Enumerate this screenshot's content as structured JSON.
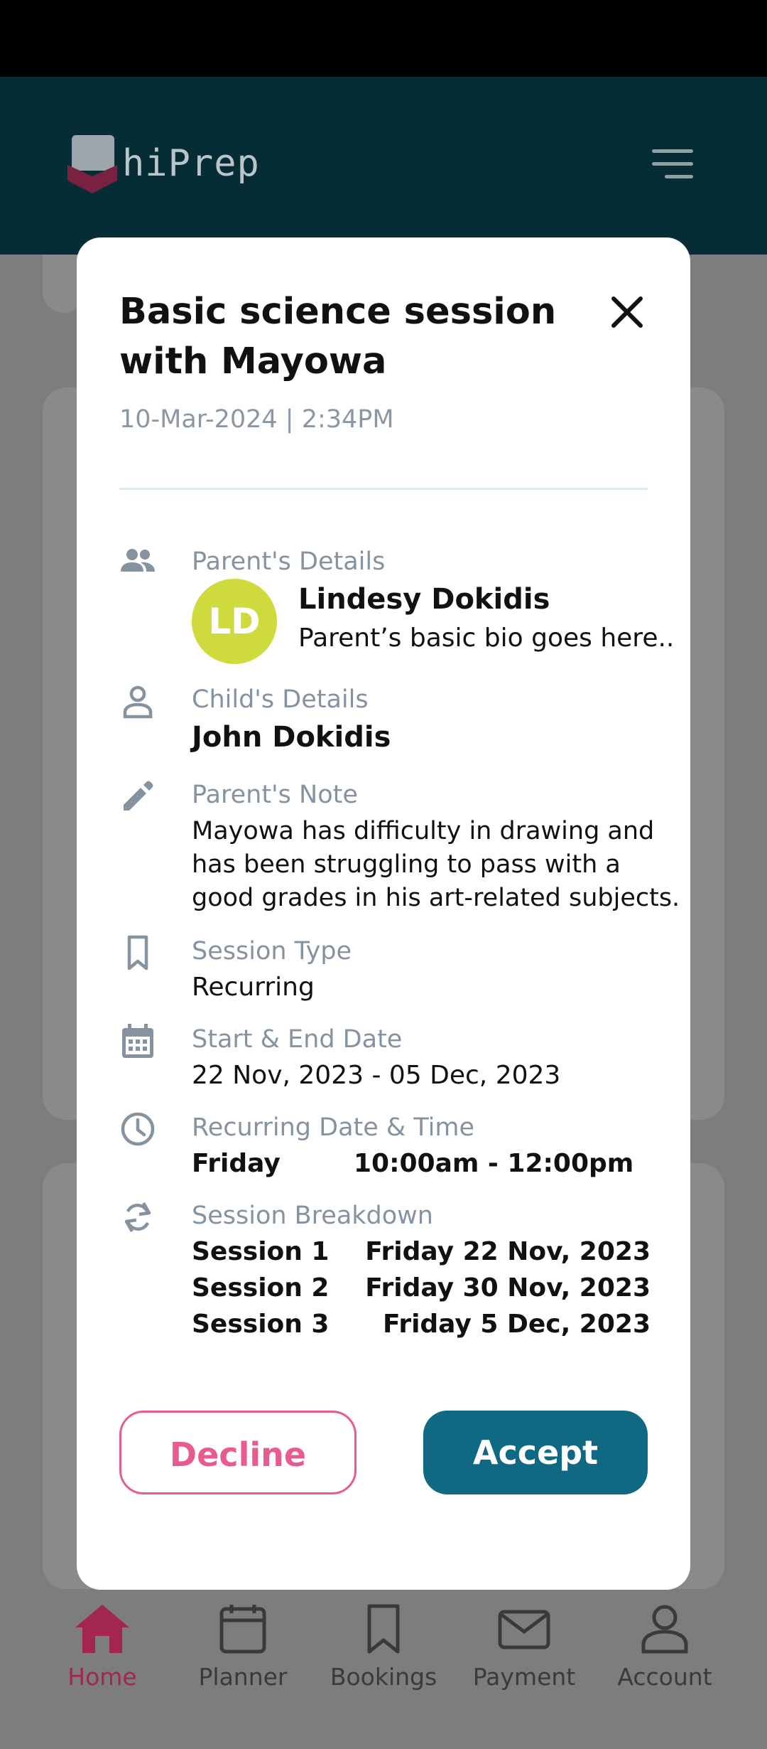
{
  "app": {
    "brand": "hiPrep"
  },
  "modal": {
    "title": "Basic science session with Mayowa",
    "datetime": "10-Mar-2024 | 2:34PM",
    "parent": {
      "label": "Parent's Details",
      "initials": "LD",
      "name": "Lindesy Dokidis",
      "bio": "Parent’s basic bio goes here..",
      "avatar_color": "#cfdb3c"
    },
    "child": {
      "label": "Child's Details",
      "name": "John Dokidis"
    },
    "note": {
      "label": "Parent's Note",
      "text": "Mayowa has difficulty in drawing and has been struggling to pass with a good grades in his art-related subjects."
    },
    "session_type": {
      "label": "Session Type",
      "value": "Recurring"
    },
    "dates": {
      "label": "Start & End Date",
      "value": "22 Nov, 2023 - 05 Dec, 2023"
    },
    "recurring": {
      "label": "Recurring Date & Time",
      "day": "Friday",
      "time": "10:00am - 12:00pm"
    },
    "breakdown": {
      "label": "Session Breakdown",
      "sessions": [
        {
          "name": "Session 1",
          "date": "Friday 22 Nov, 2023"
        },
        {
          "name": "Session 2",
          "date": "Friday 30 Nov, 2023"
        },
        {
          "name": "Session 3",
          "date": "Friday 5 Dec, 2023"
        }
      ]
    },
    "actions": {
      "decline": "Decline",
      "accept": "Accept"
    },
    "colors": {
      "decline": "#e85b91",
      "accept": "#0f6983"
    }
  },
  "bottom_nav": {
    "items": [
      {
        "label": "Home",
        "icon": "home-icon",
        "active": true
      },
      {
        "label": "Planner",
        "icon": "calendar-icon"
      },
      {
        "label": "Bookings",
        "icon": "bookmark-icon"
      },
      {
        "label": "Payment",
        "icon": "mail-icon"
      },
      {
        "label": "Account",
        "icon": "person-icon"
      }
    ]
  }
}
